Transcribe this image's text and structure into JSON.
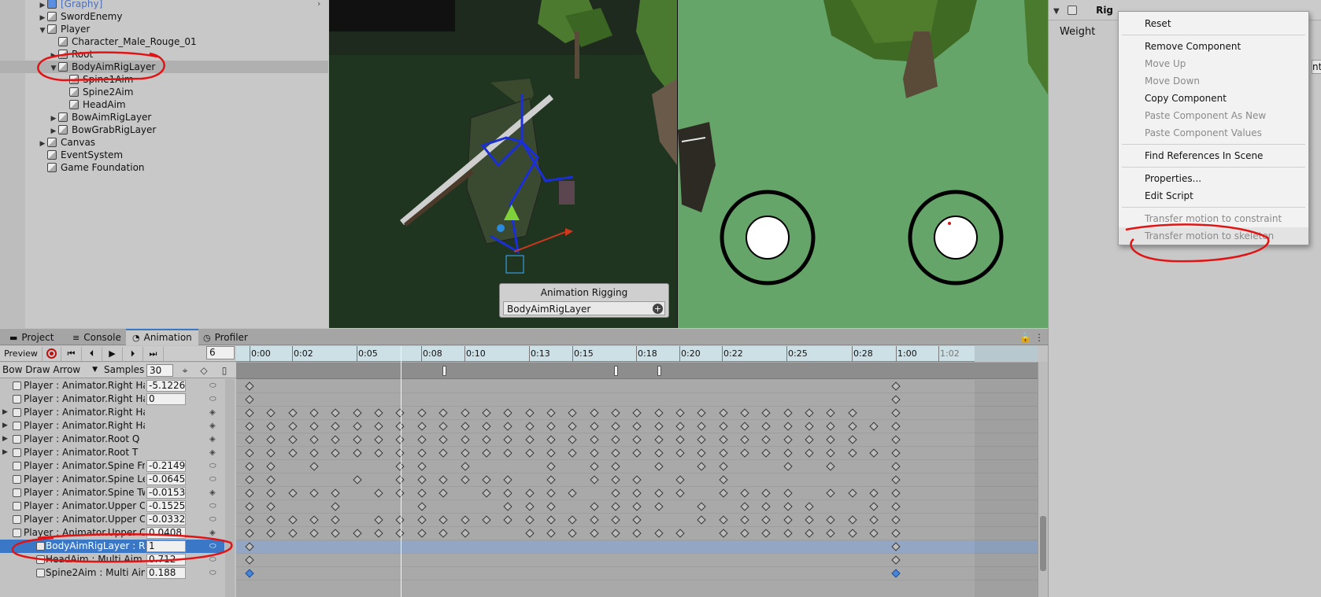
{
  "hierarchy": {
    "items": [
      {
        "label": "[Graphy]",
        "indent": 1,
        "fold": "▶",
        "graphy": true
      },
      {
        "label": "SwordEnemy",
        "indent": 1,
        "fold": "▶"
      },
      {
        "label": "Player",
        "indent": 1,
        "fold": "▼"
      },
      {
        "label": "Character_Male_Rouge_01",
        "indent": 2,
        "fold": ""
      },
      {
        "label": "Root",
        "indent": 2,
        "fold": "▶"
      },
      {
        "label": "BodyAimRigLayer",
        "indent": 2,
        "fold": "▼",
        "selected": true
      },
      {
        "label": "Spine1Aim",
        "indent": 3,
        "fold": ""
      },
      {
        "label": "Spine2Aim",
        "indent": 3,
        "fold": ""
      },
      {
        "label": "HeadAim",
        "indent": 3,
        "fold": ""
      },
      {
        "label": "BowAimRigLayer",
        "indent": 2,
        "fold": "▶"
      },
      {
        "label": "BowGrabRigLayer",
        "indent": 2,
        "fold": "▶"
      },
      {
        "label": "Canvas",
        "indent": 1,
        "fold": "▶"
      },
      {
        "label": "EventSystem",
        "indent": 1,
        "fold": ""
      },
      {
        "label": "Game Foundation",
        "indent": 1,
        "fold": ""
      }
    ]
  },
  "scene": {
    "overlay_title": "Animation Rigging",
    "overlay_item": "BodyAimRigLayer"
  },
  "inspector": {
    "component_title": "Rig",
    "weight_label": "Weight",
    "clipped_text": "nt"
  },
  "context_menu": {
    "items": [
      {
        "label": "Reset",
        "enabled": true
      },
      {
        "sep": true
      },
      {
        "label": "Remove Component",
        "enabled": true
      },
      {
        "label": "Move Up",
        "enabled": false
      },
      {
        "label": "Move Down",
        "enabled": false
      },
      {
        "label": "Copy Component",
        "enabled": true
      },
      {
        "label": "Paste Component As New",
        "enabled": false
      },
      {
        "label": "Paste Component Values",
        "enabled": false
      },
      {
        "sep": true
      },
      {
        "label": "Find References In Scene",
        "enabled": true
      },
      {
        "sep": true
      },
      {
        "label": "Properties...",
        "enabled": true
      },
      {
        "label": "Edit Script",
        "enabled": true
      },
      {
        "sep": true
      },
      {
        "label": "Transfer motion to constraint",
        "enabled": false
      },
      {
        "label": "Transfer motion to skeleton",
        "enabled": false,
        "highlight": true
      }
    ]
  },
  "tabs": [
    {
      "label": "Project",
      "icon": "folder-icon",
      "glyph": "▬"
    },
    {
      "label": "Console",
      "icon": "console-icon",
      "glyph": "≡"
    },
    {
      "label": "Animation",
      "icon": "animation-icon",
      "glyph": "◔",
      "active": true
    },
    {
      "label": "Profiler",
      "icon": "profiler-icon",
      "glyph": "◷"
    }
  ],
  "animation": {
    "preview_label": "Preview",
    "frame_value": "6",
    "clip_name": "Bow Draw Arrow",
    "samples_label": "Samples",
    "samples_value": "30",
    "ruler_labels": [
      "0:00",
      "0:02",
      "0:05",
      "0:08",
      "0:10",
      "0:13",
      "0:15",
      "0:18",
      "0:20",
      "0:22",
      "0:25",
      "0:28",
      "1:00",
      "1:02"
    ],
    "properties": [
      {
        "name": "Player : Animator.Right Han",
        "value": "-5.1226",
        "expand": false,
        "kind": "curve"
      },
      {
        "name": "Player : Animator.Right Han",
        "value": "0",
        "expand": false,
        "kind": "curve"
      },
      {
        "name": "Player : Animator.Right Hand Q",
        "value": "",
        "expand": true,
        "kind": "group"
      },
      {
        "name": "Player : Animator.Right Hand T",
        "value": "",
        "expand": true,
        "kind": "group"
      },
      {
        "name": "Player : Animator.Root Q",
        "value": "",
        "expand": true,
        "kind": "group"
      },
      {
        "name": "Player : Animator.Root T",
        "value": "",
        "expand": true,
        "kind": "group"
      },
      {
        "name": "Player : Animator.Spine Fror",
        "value": "-0.2149",
        "expand": false,
        "kind": "curve"
      },
      {
        "name": "Player : Animator.Spine Left",
        "value": "-0.0645",
        "expand": false,
        "kind": "curve"
      },
      {
        "name": "Player : Animator.Spine Twi",
        "value": "-0.0153",
        "expand": false,
        "kind": "key"
      },
      {
        "name": "Player : Animator.Upper Che",
        "value": "-0.1525",
        "expand": false,
        "kind": "curve"
      },
      {
        "name": "Player : Animator.Upper Che",
        "value": "-0.0332",
        "expand": false,
        "kind": "curve"
      },
      {
        "name": "Player : Animator.Upper Che",
        "value": "0.0408",
        "expand": false,
        "kind": "key"
      },
      {
        "name": "BodyAimRigLayer : Rig.W",
        "value": "1",
        "expand": false,
        "kind": "curve",
        "selected": true,
        "sub": true
      },
      {
        "name": "HeadAim : Multi Aim Cr",
        "value": "0.712",
        "expand": false,
        "kind": "curve",
        "sub2": true
      },
      {
        "name": "Spine2Aim  : Multi Aim",
        "value": "0.188",
        "expand": false,
        "kind": "curve",
        "sub2": true
      }
    ]
  }
}
